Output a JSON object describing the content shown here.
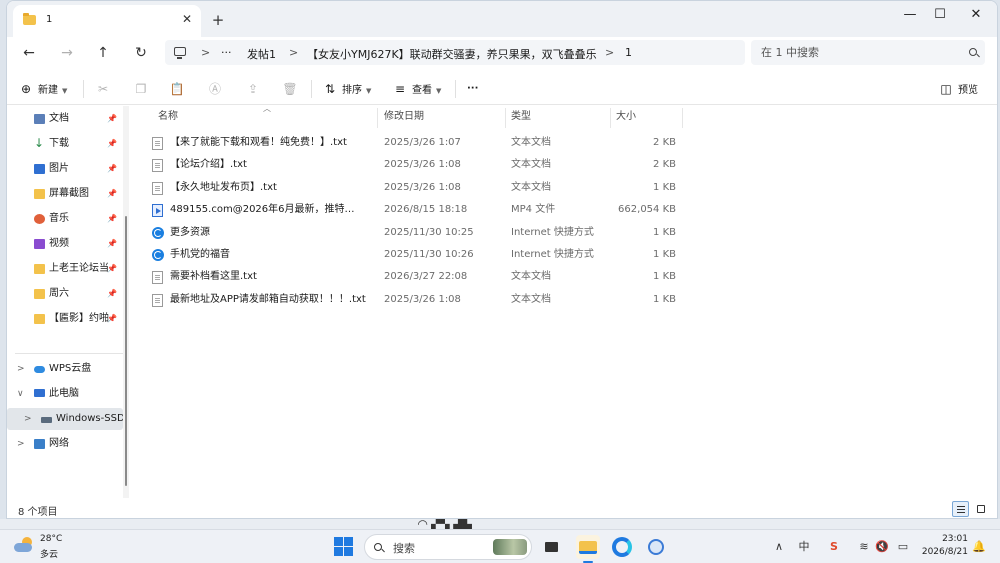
{
  "tab": {
    "title": "1",
    "close_glyph": "✕",
    "new_tab_glyph": "+"
  },
  "window_controls": {
    "minimize": "—",
    "maximize": "☐",
    "close": "✕"
  },
  "nav": {
    "back": "←",
    "forward": "→",
    "up": "↑",
    "refresh": "↻"
  },
  "breadcrumb": {
    "more": "···",
    "items": [
      "发帖1",
      "【女友小YMJ627K】联动群交骚妻，养只果果，双飞叠叠乐",
      "1"
    ],
    "sep": ">"
  },
  "search": {
    "placeholder": "在 1 中搜索"
  },
  "toolbar": {
    "new_label": "新建",
    "sort_label": "排序",
    "view_label": "查看",
    "more_label": "···",
    "preview_label": "预览"
  },
  "sidebar": {
    "quick_access": [
      {
        "label": "文档",
        "icon": "document-icon",
        "color": "#5b7fb8"
      },
      {
        "label": "下载",
        "icon": "download-icon",
        "color": "#2a8a4a"
      },
      {
        "label": "图片",
        "icon": "pictures-icon",
        "color": "#2f6fd1"
      },
      {
        "label": "屏幕截图",
        "icon": "folder-icon",
        "color": "#f3c24b"
      },
      {
        "label": "音乐",
        "icon": "music-icon",
        "color": "#e0603a"
      },
      {
        "label": "视频",
        "icon": "video-icon",
        "color": "#8a4cd0"
      },
      {
        "label": "上老王论坛当",
        "icon": "folder-icon",
        "color": "#f3c24b"
      },
      {
        "label": "周六",
        "icon": "folder-icon",
        "color": "#f3c24b"
      },
      {
        "label": "【匾影】约啪",
        "icon": "folder-icon",
        "color": "#f3c24b"
      }
    ],
    "tree": [
      {
        "label": "WPS云盘",
        "icon": "cloud-icon",
        "chevron": ">"
      },
      {
        "label": "此电脑",
        "icon": "computer-icon",
        "chevron": "∨"
      },
      {
        "label": "Windows-SSD",
        "icon": "drive-icon",
        "chevron": ">"
      },
      {
        "label": "网络",
        "icon": "network-icon",
        "chevron": ">"
      }
    ]
  },
  "columns": {
    "name": "名称",
    "date": "修改日期",
    "type": "类型",
    "size": "大小"
  },
  "files": [
    {
      "name": "【来了就能下载和观看！纯免费！】.txt",
      "date": "2025/3/26 1:07",
      "type": "文本文档",
      "size": "2 KB",
      "icon": "txt"
    },
    {
      "name": "【论坛介绍】.txt",
      "date": "2025/3/26 1:08",
      "type": "文本文档",
      "size": "2 KB",
      "icon": "txt"
    },
    {
      "name": "【永久地址发布页】.txt",
      "date": "2025/3/26 1:08",
      "type": "文本文档",
      "size": "1 KB",
      "icon": "txt"
    },
    {
      "name": "489155.com@2026年6月最新，推特清纯与...",
      "date": "2026/8/15 18:18",
      "type": "MP4 文件",
      "size": "662,054 KB",
      "icon": "mp4"
    },
    {
      "name": "更多资源",
      "date": "2025/11/30 10:25",
      "type": "Internet 快捷方式",
      "size": "1 KB",
      "icon": "url"
    },
    {
      "name": "手机党的福音",
      "date": "2025/11/30 10:26",
      "type": "Internet 快捷方式",
      "size": "1 KB",
      "icon": "url"
    },
    {
      "name": "需要补档看这里.txt",
      "date": "2026/3/27 22:08",
      "type": "文本文档",
      "size": "1 KB",
      "icon": "txt"
    },
    {
      "name": "最新地址及APP请发邮箱自动获取！！！.txt",
      "date": "2025/3/26 1:08",
      "type": "文本文档",
      "size": "1 KB",
      "icon": "txt"
    }
  ],
  "status": {
    "item_count": "8 个项目"
  },
  "taskbar": {
    "weather_temp": "28°C",
    "weather_desc": "多云",
    "search_placeholder": "搜索",
    "tray_up": "∧",
    "ime": "中",
    "time": "23:01",
    "date": "2026/8/21"
  }
}
